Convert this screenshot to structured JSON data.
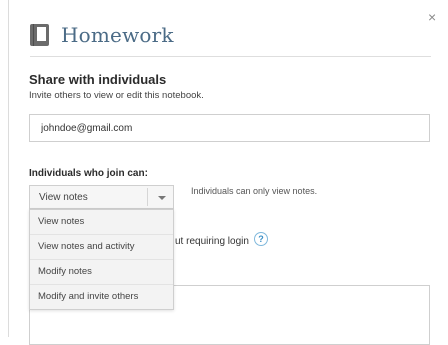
{
  "dialog": {
    "title": "Homework",
    "close_label": "×"
  },
  "share": {
    "heading": "Share with individuals",
    "subtext": "Invite others to view or edit this notebook.",
    "email_value": "johndoe@gmail.com"
  },
  "permissions": {
    "heading": "Individuals who join can:",
    "selected": "View notes",
    "description": "Individuals can only view notes.",
    "options": [
      "View notes",
      "View notes and activity",
      "Modify notes",
      "Modify and invite others"
    ]
  },
  "login_option": {
    "text_visible": "ut requiring login",
    "help_label": "?"
  },
  "colors": {
    "title": "#4b6b86",
    "help_accent": "#3a8fc7"
  },
  "icons": {
    "notebook": "notebook-icon",
    "dropdown": "chevron-down-icon",
    "help": "help-icon",
    "close": "close-icon"
  }
}
